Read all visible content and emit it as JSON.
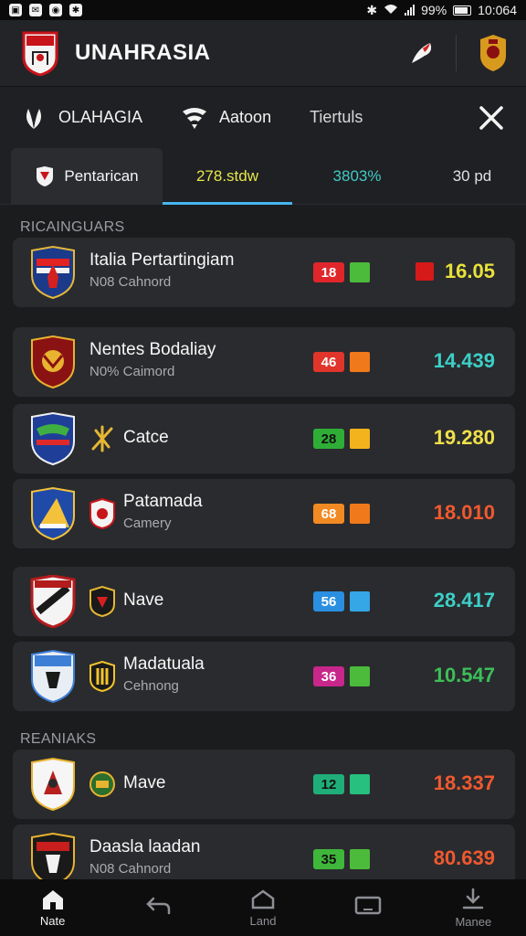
{
  "status": {
    "battery": "99%",
    "time": "10:064",
    "icons": [
      "notification-icon",
      "notification-icon",
      "notification-icon",
      "notification-icon"
    ]
  },
  "header": {
    "title": "UNAHRASIA"
  },
  "filters": [
    {
      "label": "OLAHAGIA",
      "icon": "leaf-icon"
    },
    {
      "label": "Aatoon",
      "icon": "wave-icon"
    },
    {
      "label": "Tiertuls",
      "icon": ""
    }
  ],
  "tabs": {
    "primary": "Pentarican",
    "values": [
      "278.stdw",
      "3803%",
      "30 pd"
    ]
  },
  "sections": {
    "first": "RICAINGUARS",
    "second": "REANIAKS"
  },
  "matches": [
    {
      "name": "Italia Pertartingiam",
      "sub": "N08 Cahnord",
      "score": "18",
      "value": "16.05"
    },
    {
      "name": "Nentes Bodaliay",
      "sub": "N0% Caimord",
      "score": "46",
      "value": "14.439"
    },
    {
      "name": "Catce",
      "sub": "",
      "score": "28",
      "value": "19.280"
    },
    {
      "name": "Patamada",
      "sub": "Camery",
      "score": "68",
      "value": "18.010"
    },
    {
      "name": "Nave",
      "sub": "",
      "score": "56",
      "value": "28.417"
    },
    {
      "name": "Madatuala",
      "sub": "Cehnong",
      "score": "36",
      "value": "10.547"
    },
    {
      "name": "Mave",
      "sub": "",
      "score": "12",
      "value": "18.337"
    },
    {
      "name": "Daasla laadan",
      "sub": "N08 Cahnord",
      "score": "35",
      "value": "80.639"
    }
  ],
  "colors": {
    "accent": "#47b6ef",
    "tab_yellow": "#e6e64a",
    "tab_cyan": "#41c9c4"
  },
  "nav": [
    {
      "label": "Nate",
      "icon": "home-icon"
    },
    {
      "label": "",
      "icon": "back-icon"
    },
    {
      "label": "Land",
      "icon": "triangle-icon"
    },
    {
      "label": "",
      "icon": "tablet-icon"
    },
    {
      "label": "Manee",
      "icon": "download-icon"
    }
  ]
}
